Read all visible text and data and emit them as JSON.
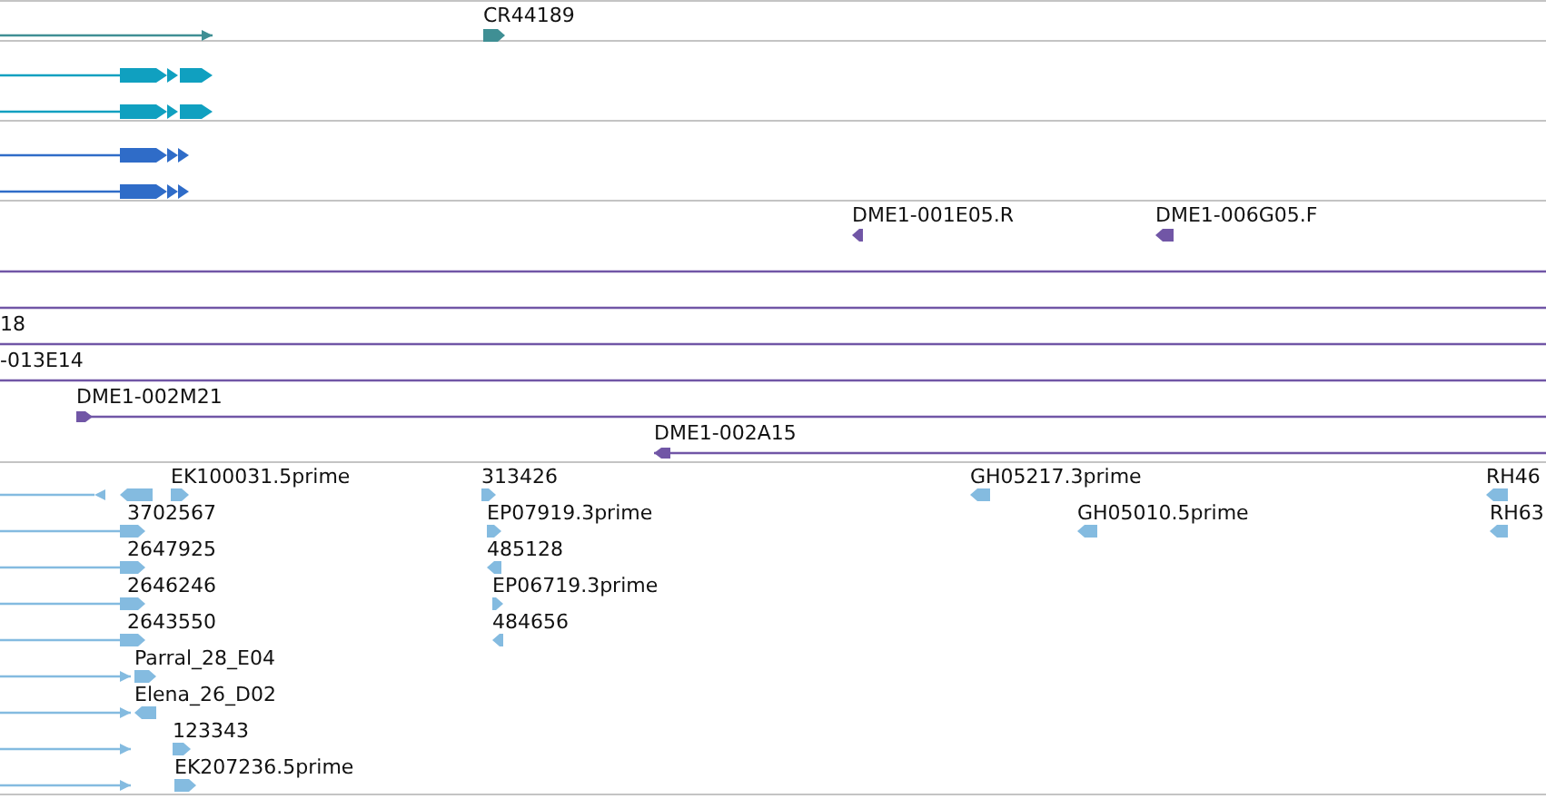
{
  "tracks": [
    {
      "color": "#3f8f94",
      "rows": [
        {
          "features": [
            {
              "kind": "span",
              "reverse": false
            },
            {
              "kind": "block",
              "label": "CR44189",
              "reverse": false
            }
          ]
        }
      ]
    },
    {
      "color": "#10a0c0",
      "rows": [
        {
          "features": [
            {
              "kind": "transcript",
              "reverse": false
            }
          ]
        },
        {
          "features": [
            {
              "kind": "transcript",
              "reverse": false
            }
          ]
        }
      ]
    },
    {
      "color": "#2f6cc8",
      "rows": [
        {
          "features": [
            {
              "kind": "transcript",
              "reverse": false
            }
          ]
        },
        {
          "features": [
            {
              "kind": "transcript",
              "reverse": false
            }
          ]
        }
      ]
    },
    {
      "color": "#7156a6",
      "rows": [
        {
          "features": [
            {
              "kind": "block",
              "label": "DME1-001E05.R",
              "reverse": true
            },
            {
              "kind": "block",
              "label": "DME1-006G05.F",
              "reverse": true
            }
          ]
        },
        {
          "features": [
            {
              "kind": "line"
            }
          ]
        },
        {
          "features": [
            {
              "kind": "line"
            }
          ]
        },
        {
          "features": [
            {
              "kind": "line",
              "label": "18"
            }
          ]
        },
        {
          "features": [
            {
              "kind": "line",
              "label": "-013E14"
            }
          ]
        },
        {
          "features": [
            {
              "kind": "clone",
              "label": "DME1-002M21",
              "reverse": false
            }
          ]
        },
        {
          "features": [
            {
              "kind": "clone",
              "label": "DME1-002A15",
              "reverse": true
            }
          ]
        }
      ]
    },
    {
      "color": "#84bbe0",
      "rows": [
        {
          "features": [
            {
              "kind": "span",
              "reverse": true
            },
            {
              "kind": "block",
              "reverse": true
            },
            {
              "kind": "block",
              "label": "EK100031.5prime",
              "reverse": false
            },
            {
              "kind": "block",
              "label": "313426",
              "reverse": false
            },
            {
              "kind": "block",
              "label": "GH05217.3prime",
              "reverse": true
            },
            {
              "kind": "block",
              "label": "RH46",
              "reverse": true
            }
          ]
        },
        {
          "features": [
            {
              "kind": "line"
            },
            {
              "kind": "block",
              "label": "3702567",
              "reverse": false
            },
            {
              "kind": "block",
              "label": "EP07919.3prime",
              "reverse": false
            },
            {
              "kind": "block",
              "label": "GH05010.5prime",
              "reverse": true
            },
            {
              "kind": "block",
              "label": "RH63",
              "reverse": true
            }
          ]
        },
        {
          "features": [
            {
              "kind": "line"
            },
            {
              "kind": "block",
              "label": "2647925",
              "reverse": false
            },
            {
              "kind": "block",
              "label": "485128",
              "reverse": true
            }
          ]
        },
        {
          "features": [
            {
              "kind": "line"
            },
            {
              "kind": "block",
              "label": "2646246",
              "reverse": false
            },
            {
              "kind": "block",
              "label": "EP06719.3prime",
              "reverse": false
            }
          ]
        },
        {
          "features": [
            {
              "kind": "line"
            },
            {
              "kind": "block",
              "label": "2643550",
              "reverse": false
            },
            {
              "kind": "block",
              "label": "484656",
              "reverse": true
            }
          ]
        },
        {
          "features": [
            {
              "kind": "span",
              "reverse": false
            },
            {
              "kind": "block",
              "label": "Parral_28_E04",
              "reverse": false
            }
          ]
        },
        {
          "features": [
            {
              "kind": "span",
              "reverse": false
            },
            {
              "kind": "block",
              "label": "Elena_26_D02",
              "reverse": true
            }
          ]
        },
        {
          "features": [
            {
              "kind": "span",
              "reverse": false
            },
            {
              "kind": "block",
              "label": "123343",
              "reverse": false
            }
          ]
        },
        {
          "features": [
            {
              "kind": "span",
              "reverse": false
            },
            {
              "kind": "block",
              "label": "EK207236.5prime",
              "reverse": false
            }
          ]
        }
      ]
    }
  ]
}
